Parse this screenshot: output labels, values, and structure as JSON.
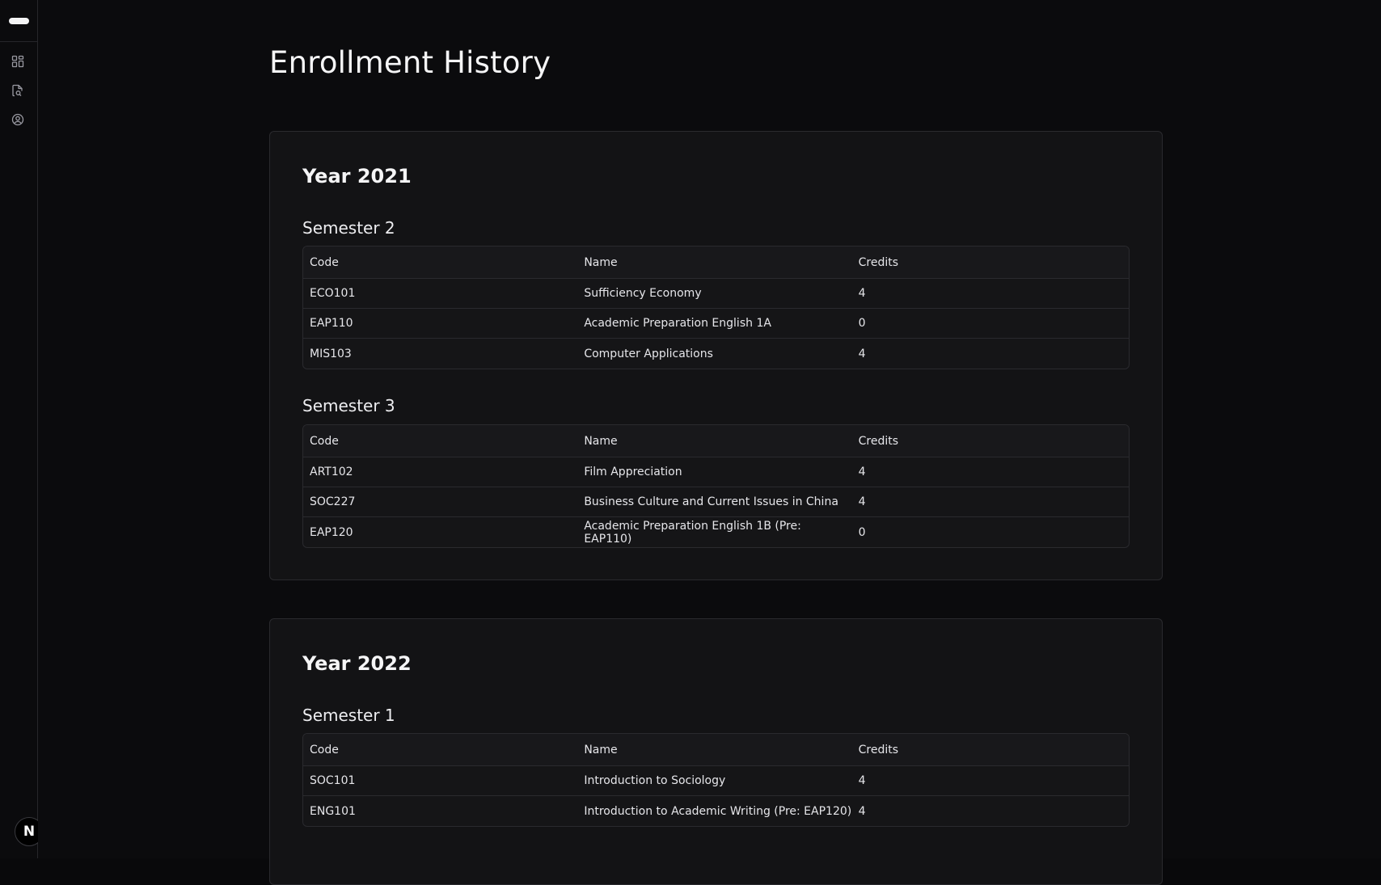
{
  "page": {
    "title": "Enrollment History"
  },
  "sidebar": {
    "brand": "N"
  },
  "table_headers": {
    "code": "Code",
    "name": "Name",
    "credits": "Credits"
  },
  "years": [
    {
      "title": "Year 2021",
      "semesters": [
        {
          "title": "Semester 2",
          "rows": [
            {
              "code": "ECO101",
              "name": "Sufficiency Economy",
              "credits": "4"
            },
            {
              "code": "EAP110",
              "name": "Academic Preparation English 1A",
              "credits": "0"
            },
            {
              "code": "MIS103",
              "name": "Computer Applications",
              "credits": "4"
            }
          ]
        },
        {
          "title": "Semester 3",
          "rows": [
            {
              "code": "ART102",
              "name": "Film Appreciation",
              "credits": "4"
            },
            {
              "code": "SOC227",
              "name": "Business Culture and Current Issues in China",
              "credits": "4"
            },
            {
              "code": "EAP120",
              "name": "Academic Preparation English 1B (Pre: EAP110)",
              "credits": "0"
            }
          ]
        }
      ]
    },
    {
      "title": "Year 2022",
      "semesters": [
        {
          "title": "Semester 1",
          "rows": [
            {
              "code": "SOC101",
              "name": "Introduction to Sociology",
              "credits": "4"
            },
            {
              "code": "ENG101",
              "name": "Introduction to Academic Writing (Pre: EAP120)",
              "credits": "4"
            }
          ]
        }
      ]
    }
  ]
}
